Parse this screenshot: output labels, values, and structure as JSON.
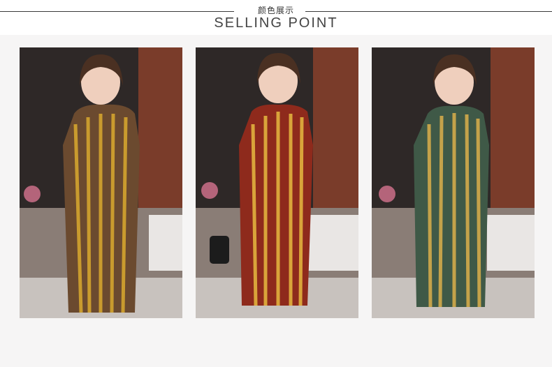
{
  "header": {
    "title_cn": "颜色展示",
    "title_en": "SELLING POINT"
  },
  "gallery": {
    "photos": [
      {
        "label": "model-dress-brown-stripe",
        "dress_color": "#6b4a2f",
        "accent": "#c99b2e"
      },
      {
        "label": "model-dress-red-stripe",
        "dress_color": "#8e2a1c",
        "accent": "#d9a43a"
      },
      {
        "label": "model-dress-green-stripe",
        "dress_color": "#3f5947",
        "accent": "#c4a24a"
      }
    ]
  },
  "colors": {
    "background": "#f6f5f5",
    "header_bg": "#ffffff",
    "rule": "#3a3a3a"
  }
}
